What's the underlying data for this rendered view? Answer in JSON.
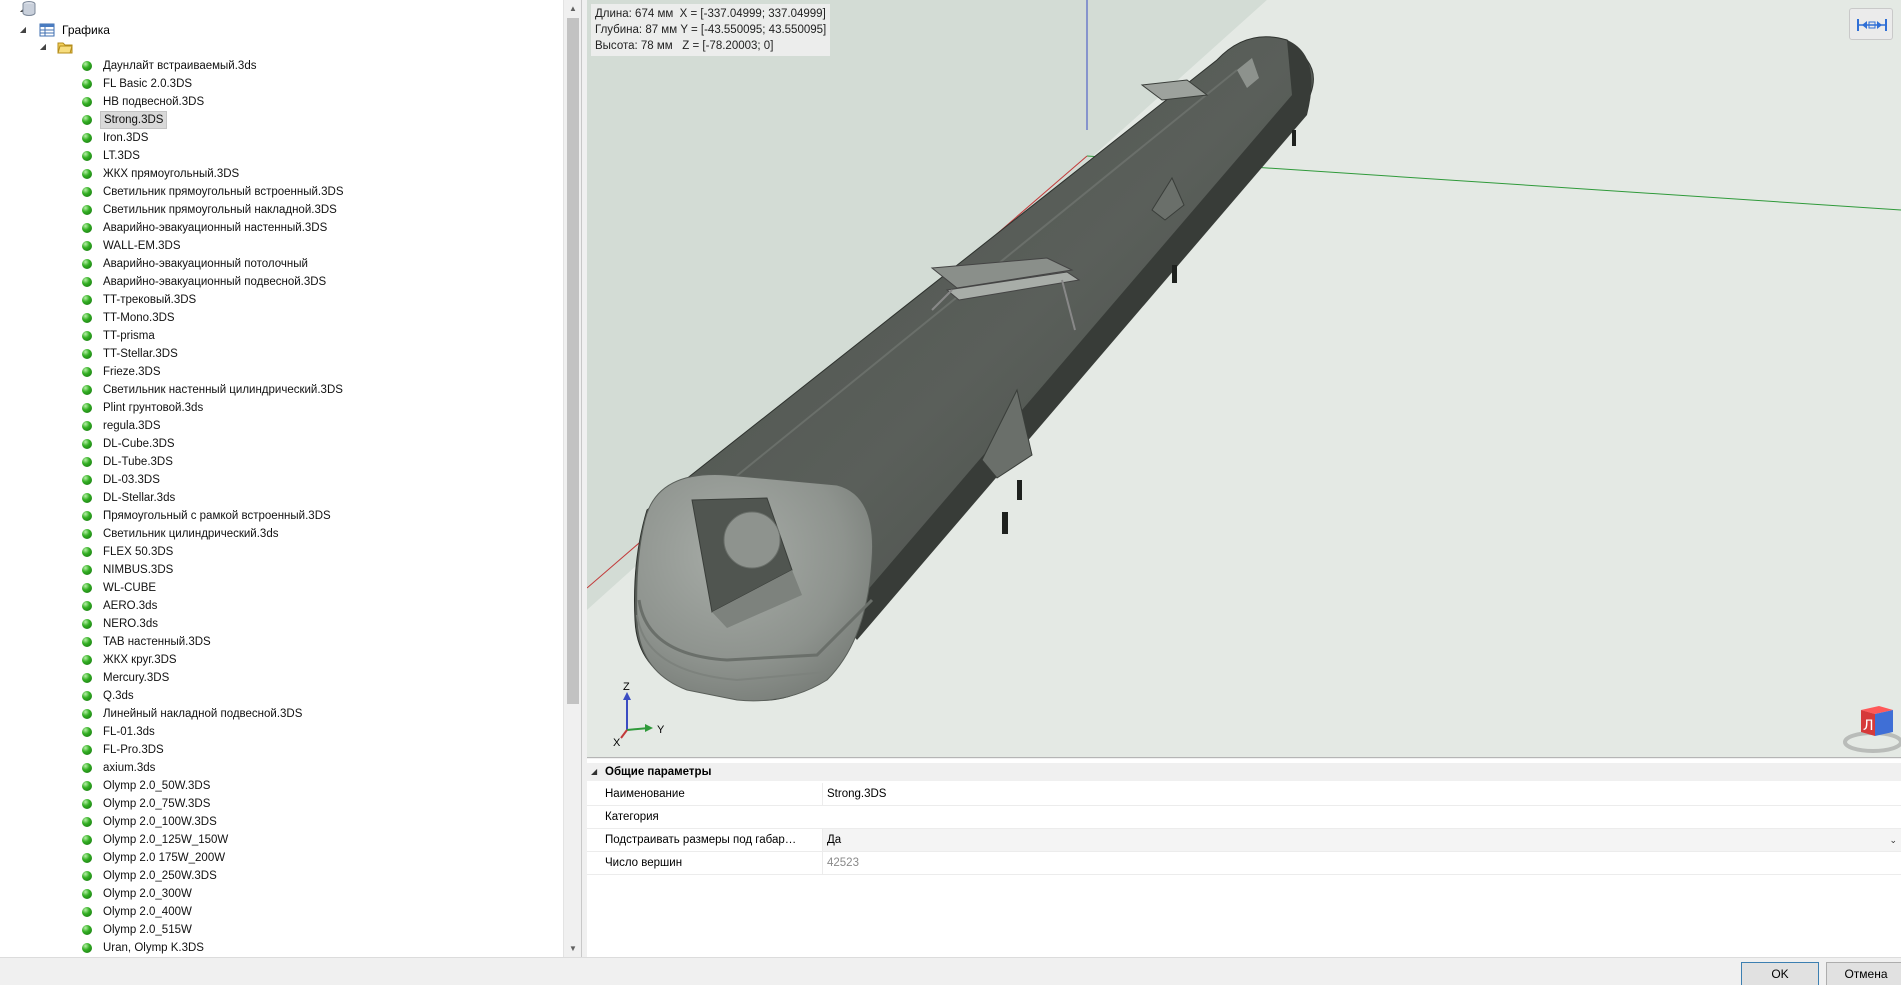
{
  "tree": {
    "root_label": "Графика",
    "selected_item": "Strong.3DS",
    "items": [
      "Даунлайт встраиваемый.3ds",
      "FL Basic 2.0.3DS",
      "НВ подвесной.3DS",
      "Strong.3DS",
      "Iron.3DS",
      "LT.3DS",
      "ЖКХ прямоугольный.3DS",
      "Светильник прямоугольный встроенный.3DS",
      "Светильник прямоугольный накладной.3DS",
      "Аварийно-эвакуационный настенный.3DS",
      "WALL-EM.3DS",
      "Аварийно-эвакуационный потолочный",
      "Аварийно-эвакуационный подвесной.3DS",
      "TT-трековый.3DS",
      "TT-Mono.3DS",
      "TT-prisma",
      "TT-Stellar.3DS",
      "Frieze.3DS",
      "Светильник настенный цилиндрический.3DS",
      "Plint грунтовой.3ds",
      "regula.3DS",
      "DL-Cube.3DS",
      "DL-Tube.3DS",
      "DL-03.3DS",
      "DL-Stellar.3ds",
      "Прямоугольный с рамкой встроенный.3DS",
      "Светильник цилиндрический.3ds",
      "FLEX 50.3DS",
      "NIMBUS.3DS",
      "WL-CUBE",
      "AERO.3ds",
      "NERO.3ds",
      "TAB настенный.3DS",
      "ЖКХ круг.3DS",
      "Mercury.3DS",
      "Q.3ds",
      "Линейный накладной подвесной.3DS",
      "FL-01.3ds",
      "FL-Pro.3DS",
      "axium.3ds",
      "Olymp 2.0_50W.3DS",
      "Olymp 2.0_75W.3DS",
      "Olymp 2.0_100W.3DS",
      "Olymp 2.0_125W_150W",
      "Olymp 2.0 175W_200W",
      "Olymp 2.0_250W.3DS",
      "Olymp 2.0_300W",
      "Olymp 2.0_400W",
      "Olymp 2.0_515W",
      "Uran, Olymp K.3DS"
    ]
  },
  "viewport": {
    "dims": {
      "length": "Длина: 674 мм",
      "x_range": "X = [-337.04999; 337.04999]",
      "depth": "Глубина: 87 мм",
      "y_range": "Y = [-43.550095; 43.550095]",
      "height": "Высота: 78 мм",
      "z_range": "Z = [-78.20003; 0]"
    },
    "axis_labels": {
      "x": "X",
      "y": "Y",
      "z": "Z"
    },
    "nav_cube_label": "Л",
    "colors": {
      "background": "#e4e9e4",
      "model": "#555a55",
      "wall": "#cfd9d2",
      "x_axis": "#c23a3a",
      "y_axis": "#2f9a3a",
      "z_axis": "#3a4cc2"
    }
  },
  "properties": {
    "group_title": "Общие параметры",
    "rows": [
      {
        "name": "Наименование",
        "value": "Strong.3DS"
      },
      {
        "name": "Категория",
        "value": ""
      },
      {
        "name": "Подстраивать размеры под габарит...",
        "value": "Да"
      },
      {
        "name": "Число вершин",
        "value": "42523"
      }
    ]
  },
  "buttons": {
    "ok": "OK",
    "cancel": "Отмена"
  }
}
